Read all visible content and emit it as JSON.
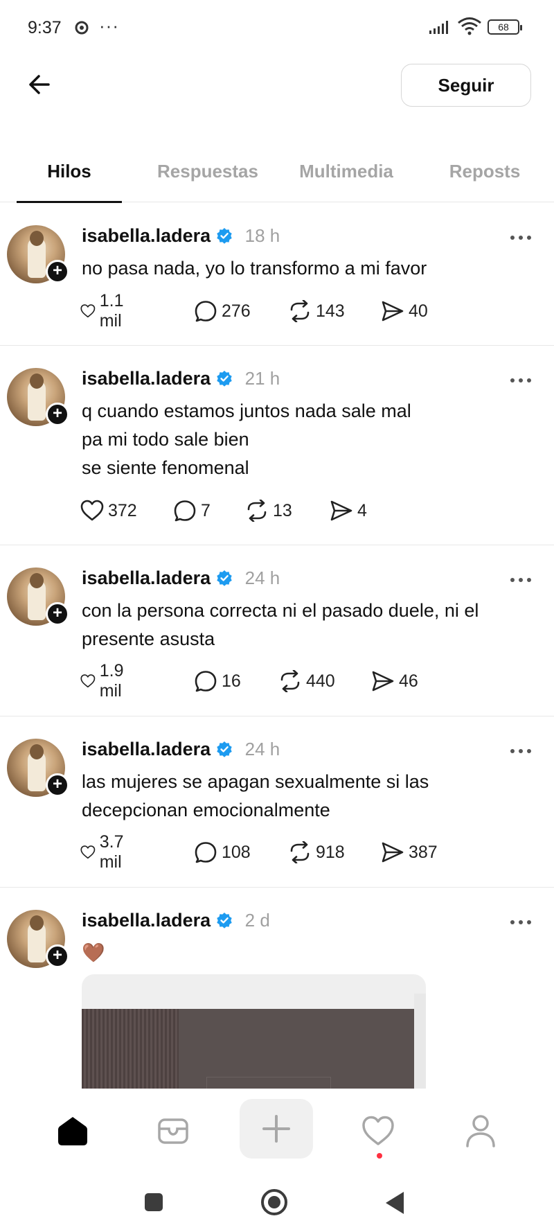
{
  "status_bar": {
    "time": "9:37",
    "more": "···",
    "battery": "68"
  },
  "header": {
    "back_icon": "arrow-left-icon",
    "follow_label": "Seguir"
  },
  "tabs": [
    {
      "label": "Hilos",
      "active": true
    },
    {
      "label": "Respuestas",
      "active": false
    },
    {
      "label": "Multimedia",
      "active": false
    },
    {
      "label": "Reposts",
      "active": false
    }
  ],
  "posts": [
    {
      "username": "isabella.ladera",
      "time": "18 h",
      "text": "no pasa nada, yo lo transformo a mi favor",
      "likes": "1.1 mil",
      "comments": "276",
      "reposts": "143",
      "shares": "40"
    },
    {
      "username": "isabella.ladera",
      "time": "21 h",
      "text": "q cuando estamos juntos nada sale mal\npa mi todo sale bien\nse siente fenomenal",
      "likes": "372",
      "comments": "7",
      "reposts": "13",
      "shares": "4"
    },
    {
      "username": "isabella.ladera",
      "time": "24 h",
      "text": "con la persona correcta ni el pasado duele, ni el\npresente asusta",
      "likes": "1.9 mil",
      "comments": "16",
      "reposts": "440",
      "shares": "46"
    },
    {
      "username": "isabella.ladera",
      "time": "24 h",
      "text": "las mujeres se apagan sexualmente si las\ndecepcionan emocionalmente",
      "likes": "3.7 mil",
      "comments": "108",
      "reposts": "918",
      "shares": "387"
    },
    {
      "username": "isabella.ladera",
      "time": "2 d",
      "text": "🤎"
    }
  ],
  "colors": {
    "verified": "#1d9bf0",
    "notif_dot": "#ff3040",
    "muted": "#a0a0a0"
  },
  "bottom_nav": [
    "home-icon",
    "messages-icon",
    "create-icon",
    "activity-icon",
    "profile-icon"
  ]
}
